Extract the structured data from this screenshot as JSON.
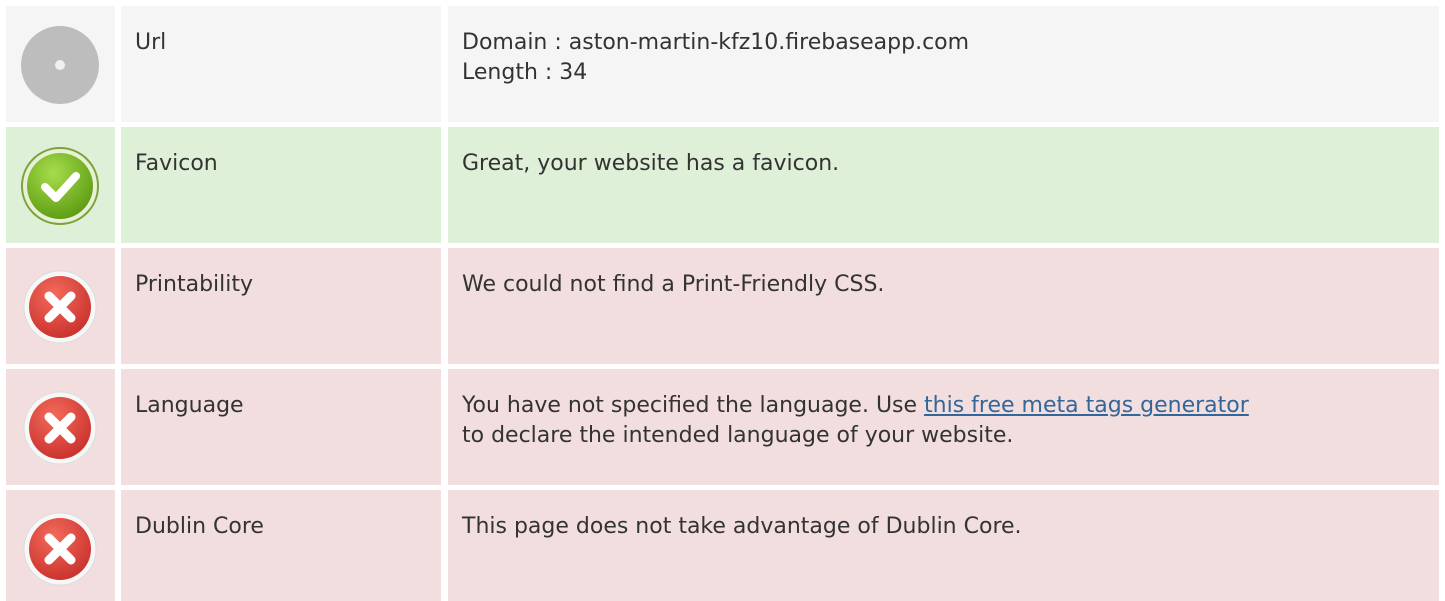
{
  "rows": [
    {
      "status": "neutral",
      "icon": "info-circle-icon",
      "label": "Url",
      "lines": [
        "Domain : aston-martin-kfz10.firebaseapp.com",
        "Length : 34"
      ]
    },
    {
      "status": "good",
      "icon": "checkmark-circle-icon",
      "label": "Favicon",
      "text": "Great, your website has a favicon."
    },
    {
      "status": "bad",
      "icon": "error-cross-icon",
      "label": "Printability",
      "text": "We could not find a Print-Friendly CSS."
    },
    {
      "status": "bad",
      "icon": "error-cross-icon",
      "label": "Language",
      "text_before": "You have not specified the language. Use ",
      "link_text": "this free meta tags generator",
      "text_after": "to declare the intended language of your website."
    },
    {
      "status": "bad",
      "icon": "error-cross-icon",
      "label": "Dublin Core",
      "text": "This page does not take advantage of Dublin Core."
    }
  ],
  "colors": {
    "neutral_bg": "#f5f5f5",
    "good_bg": "#dff0d8",
    "bad_bg": "#f2dede",
    "link": "#336699",
    "text": "#333333"
  }
}
